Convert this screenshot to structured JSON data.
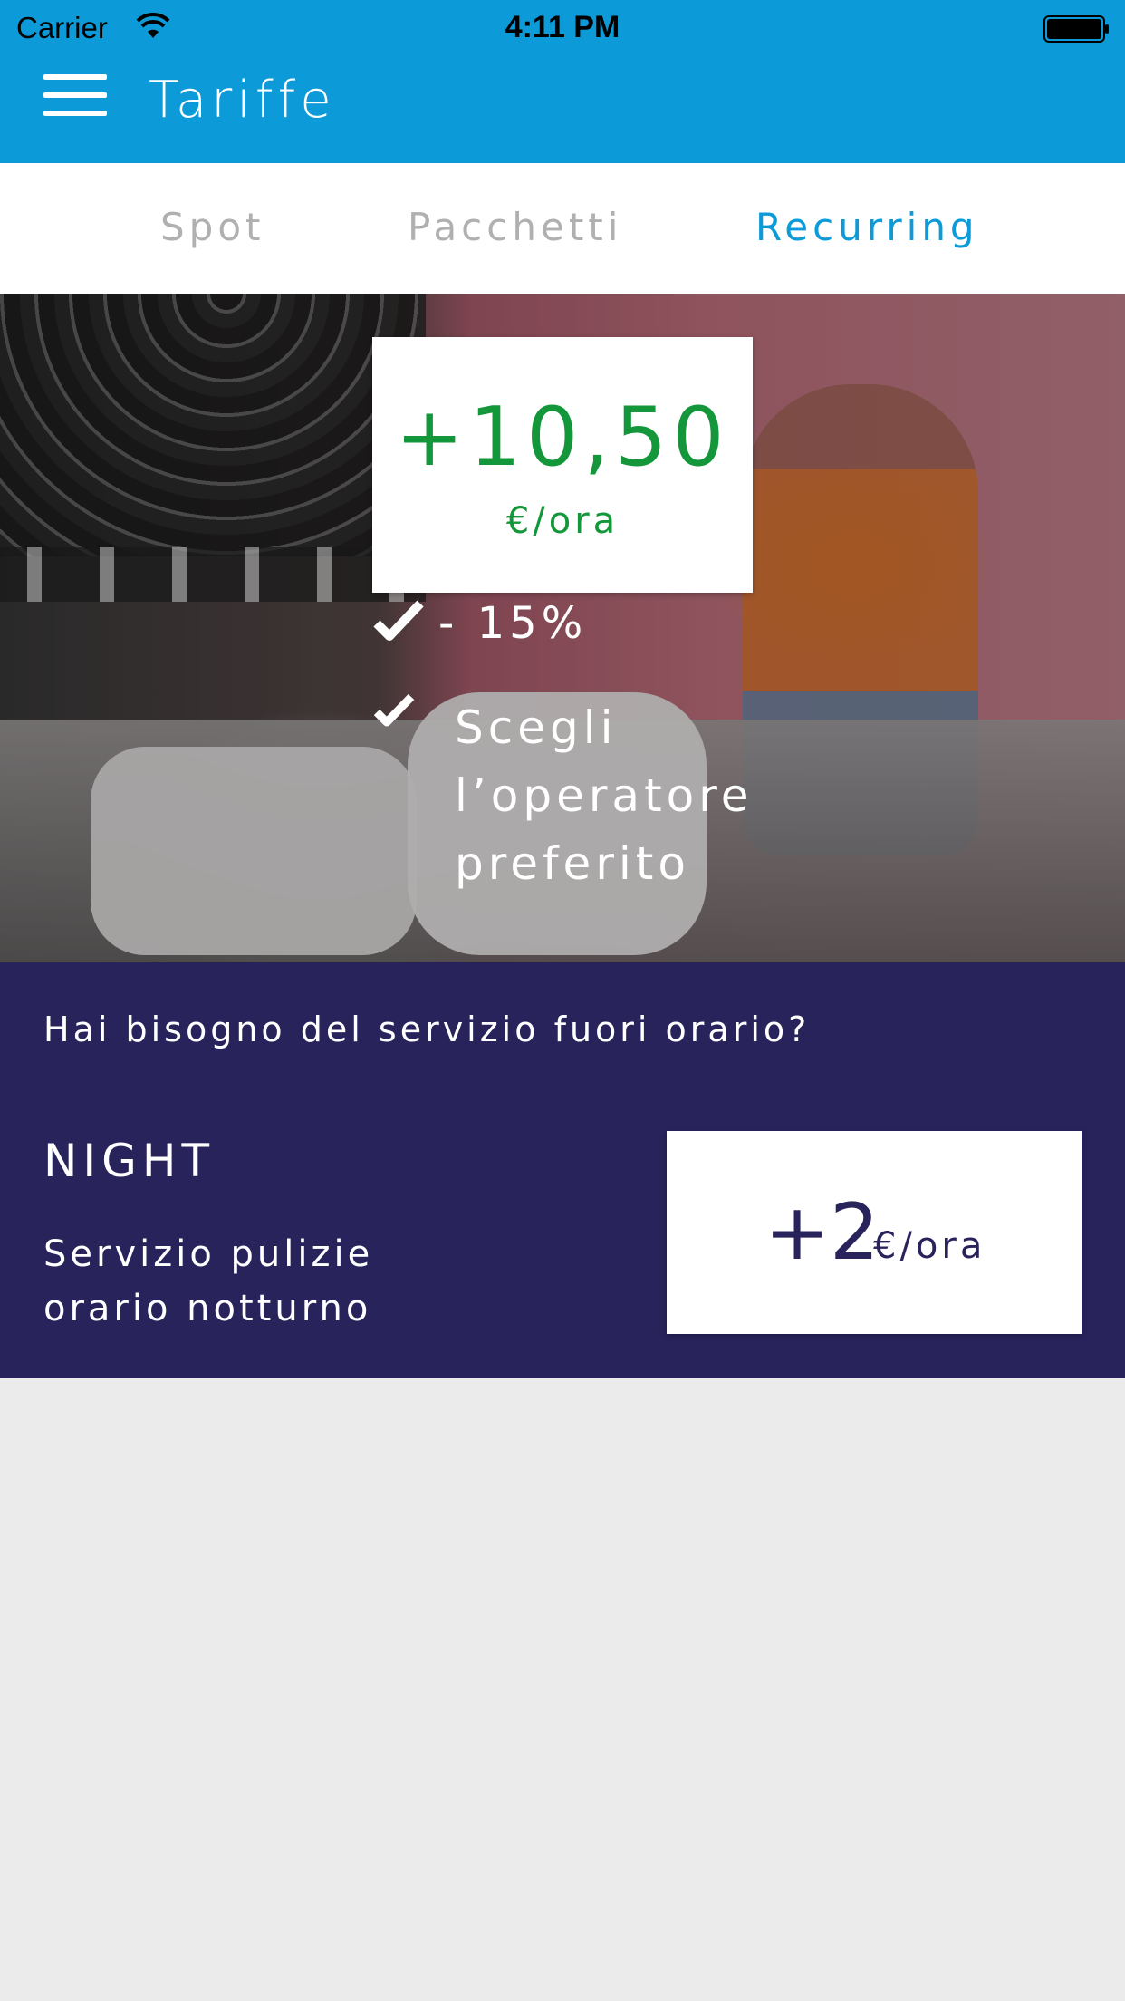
{
  "status_bar": {
    "carrier": "Carrier",
    "time": "4:11 PM",
    "icons": [
      "wifi-icon",
      "battery-icon"
    ]
  },
  "nav": {
    "title": "Tariffe",
    "menu_icon": "hamburger-menu-icon"
  },
  "tabs": [
    {
      "label": "Spot",
      "active": false
    },
    {
      "label": "Pacchetti",
      "active": false
    },
    {
      "label": "Recurring",
      "active": true
    }
  ],
  "recurring": {
    "price": "+10,50",
    "unit": "€/ora",
    "features": [
      {
        "icon": "check-icon",
        "text": "- 15%"
      },
      {
        "icon": "check-icon",
        "lines": [
          "Scegli",
          "l’operatore",
          "preferito"
        ]
      }
    ]
  },
  "night": {
    "question": "Hai bisogno del servizio fuori orario?",
    "title": "NIGHT",
    "description_lines": [
      "Servizio pulizie",
      "orario notturno"
    ],
    "price": "+2",
    "unit": "€/ora"
  },
  "colors": {
    "primary": "#0c9bd8",
    "tab_inactive": "#b0b0b0",
    "price_green": "#14973a",
    "night_bg": "#29235c",
    "page_bg": "#ebebeb"
  }
}
